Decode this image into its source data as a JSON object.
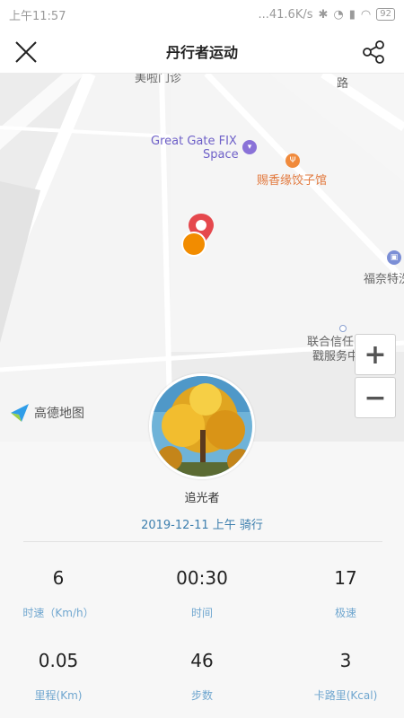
{
  "status_bar": {
    "time": "上午11:57",
    "network_speed": "...41.6K/s",
    "battery": "92"
  },
  "header": {
    "title": "丹行者运动"
  },
  "map": {
    "labels": {
      "top_partial": "美啦门诊",
      "top_right_partial": "路",
      "great_gate_line1": "Great Gate FIX",
      "great_gate_line2": "Space",
      "restaurant": "赐香缘饺子馆",
      "fuina": "福奈特洗",
      "union_line1": "联合信任时间",
      "union_line2": "戳服务中"
    },
    "brand": "高德地图",
    "zoom_in": "+",
    "zoom_out": "−"
  },
  "profile": {
    "username": "追光者",
    "activity": "2019-12-11 上午 骑行"
  },
  "stats": [
    {
      "value": "6",
      "label": "时速（Km/h）"
    },
    {
      "value": "00:30",
      "label": "时间"
    },
    {
      "value": "17",
      "label": "极速"
    },
    {
      "value": "0.05",
      "label": "里程(Km)"
    },
    {
      "value": "46",
      "label": "步数"
    },
    {
      "value": "3",
      "label": "卡路里(Kcal)"
    }
  ]
}
